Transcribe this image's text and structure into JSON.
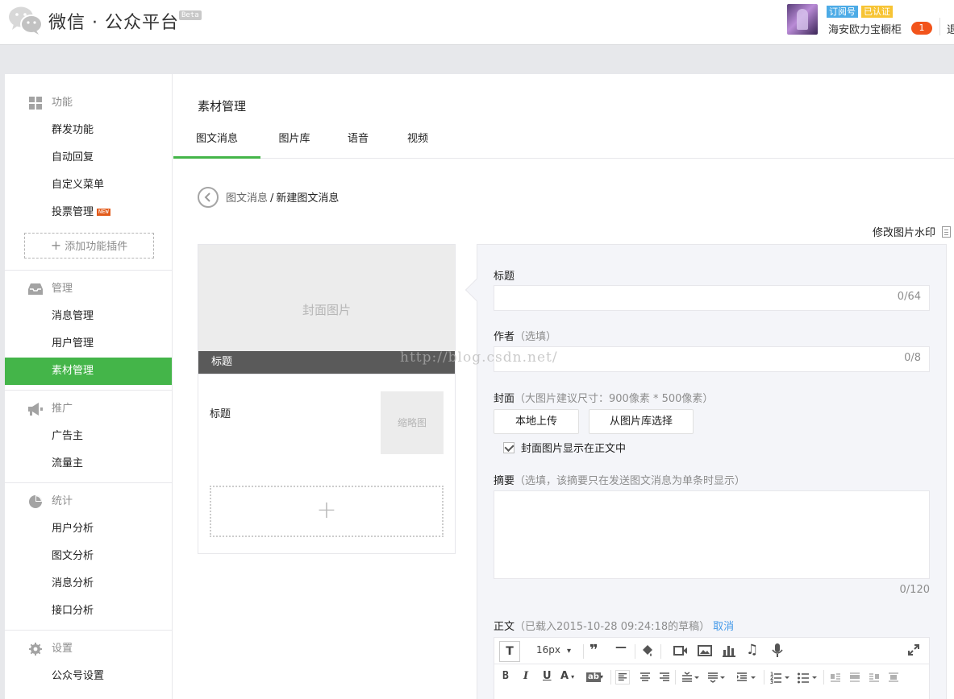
{
  "header": {
    "brand": "微信 · 公众平台",
    "beta": "Beta",
    "tag_subscription": "订阅号",
    "tag_verified": "已认证",
    "account_name": "海安欧力宝橱柜",
    "notification_count": "1",
    "logout": "退出"
  },
  "sidebar": {
    "groups": [
      {
        "title": "功能",
        "items": [
          "群发功能",
          "自动回复",
          "自定义菜单",
          "投票管理"
        ],
        "new_badge": "NEW",
        "add_plugin": "添加功能插件"
      },
      {
        "title": "管理",
        "items": [
          "消息管理",
          "用户管理",
          "素材管理"
        ]
      },
      {
        "title": "推广",
        "items": [
          "广告主",
          "流量主"
        ]
      },
      {
        "title": "统计",
        "items": [
          "用户分析",
          "图文分析",
          "消息分析",
          "接口分析"
        ]
      },
      {
        "title": "设置",
        "items": [
          "公众号设置"
        ]
      }
    ]
  },
  "main": {
    "page_title": "素材管理",
    "tabs": [
      "图文消息",
      "图片库",
      "语音",
      "视频"
    ],
    "breadcrumb": {
      "parent": "图文消息",
      "separator": "/",
      "current": "新建图文消息"
    },
    "watermark_link": "修改图片水印"
  },
  "preview": {
    "cover_placeholder": "封面图片",
    "cover_title": "标题",
    "sub_title": "标题",
    "thumb_placeholder": "缩略图",
    "add_symbol": "+"
  },
  "editor": {
    "title_label": "标题",
    "title_counter": "0/64",
    "author_label": "作者",
    "author_hint": "（选填）",
    "author_counter": "0/8",
    "cover_label": "封面",
    "cover_hint": "（大图片建议尺寸：900像素 * 500像素）",
    "upload_local": "本地上传",
    "choose_library": "从图片库选择",
    "show_cover_checkbox": "封面图片显示在正文中",
    "summary_label": "摘要",
    "summary_hint": "（选填，该摘要只在发送图文消息为单条时显示）",
    "summary_counter": "0/120",
    "body_label": "正文",
    "body_hint": "（已载入2015-10-28 09:24:18的草稿）",
    "body_cancel": "取消",
    "font_size": "16px"
  },
  "site_watermark": "http://blog.csdn.net/",
  "colors": {
    "accent": "#44b549",
    "link": "#459ae9",
    "badge": "#f2541b"
  }
}
